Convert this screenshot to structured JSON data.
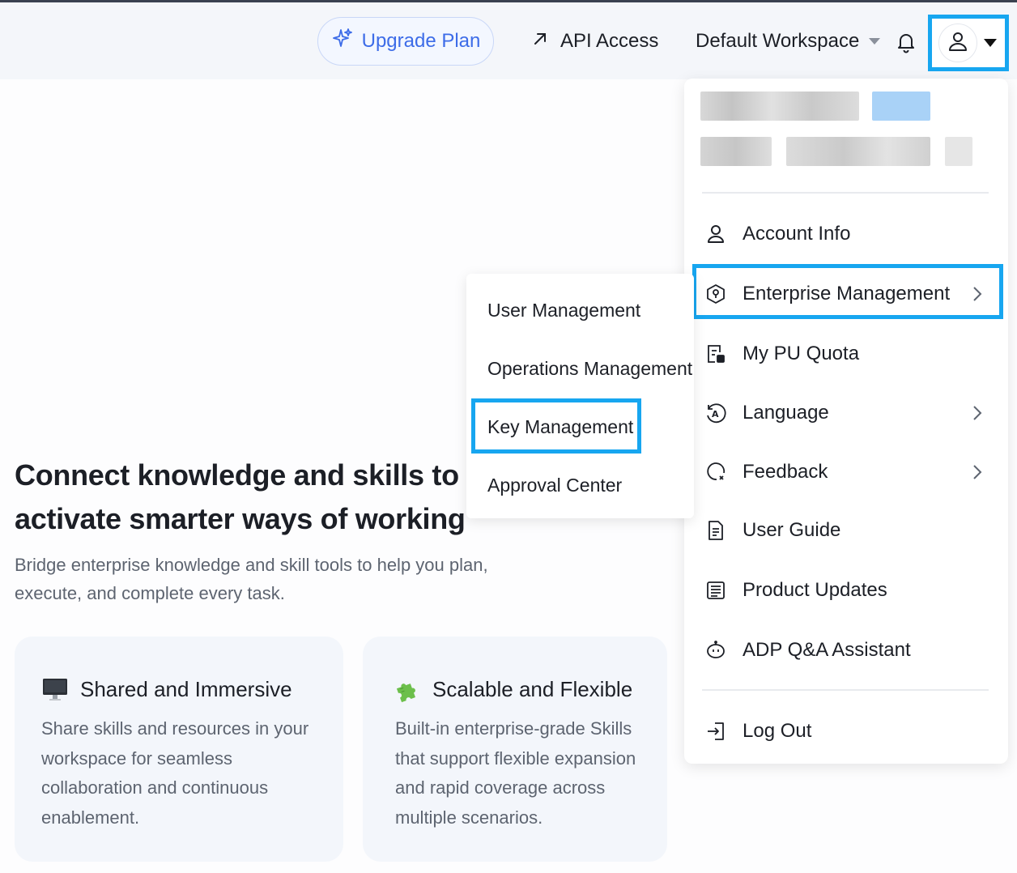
{
  "topbar": {
    "upgrade_label": "Upgrade Plan",
    "api_label": "API Access",
    "workspace_label": "Default Workspace"
  },
  "hero": {
    "title": "Connect knowledge and skills to activate smarter ways of working",
    "subtitle": "Bridge enterprise knowledge and skill tools to help you plan, execute, and complete every task."
  },
  "cards": [
    {
      "icon": "monitor-icon",
      "title": "Shared and Immersive",
      "body": "Share skills and resources in your workspace for seamless collaboration and continuous enablement."
    },
    {
      "icon": "puzzle-icon",
      "title": "Scalable and Flexible",
      "body": "Built-in enterprise-grade Skills that support flexible expansion and rapid coverage across multiple scenarios."
    }
  ],
  "user_menu": {
    "items": [
      {
        "label": "Account Info",
        "icon": "user-icon"
      },
      {
        "label": "Enterprise Management",
        "icon": "shield-icon",
        "has_submenu": true
      },
      {
        "label": "My PU Quota",
        "icon": "quota-icon"
      },
      {
        "label": "Language",
        "icon": "language-icon",
        "has_submenu": true
      },
      {
        "label": "Feedback",
        "icon": "feedback-icon",
        "has_submenu": true
      },
      {
        "label": "User Guide",
        "icon": "document-icon"
      },
      {
        "label": "Product Updates",
        "icon": "news-icon"
      },
      {
        "label": "ADP Q&A Assistant",
        "icon": "robot-icon"
      }
    ],
    "logout_label": "Log Out"
  },
  "enterprise_submenu": {
    "items": [
      "User Management",
      "Operations Management",
      "Key Management",
      "Approval Center"
    ]
  },
  "colors": {
    "highlight": "#17a6f0",
    "accent": "#3d6ce8"
  }
}
